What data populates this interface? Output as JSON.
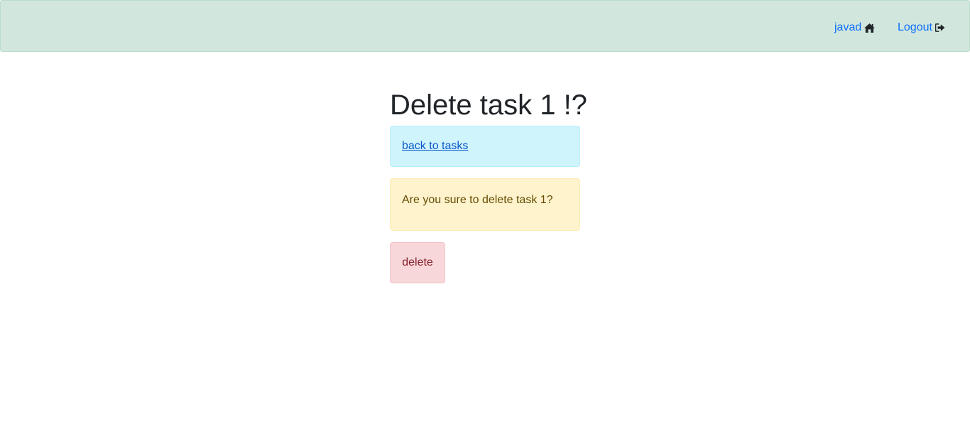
{
  "navbar": {
    "user_link": {
      "label": "javad",
      "icon": "home-icon"
    },
    "logout_link": {
      "label": "Logout",
      "icon": "sign-out-icon"
    },
    "colors": {
      "background": "#d1e7dd",
      "link": "#0d6efd"
    }
  },
  "main": {
    "title": "Delete task 1 !?",
    "back_link": "back to tasks",
    "confirm_message": "Are you sure to delete task 1?",
    "delete_button": "delete"
  },
  "colors": {
    "info": "#cff4fc",
    "warning": "#fff3cd",
    "danger": "#f8d7da"
  }
}
